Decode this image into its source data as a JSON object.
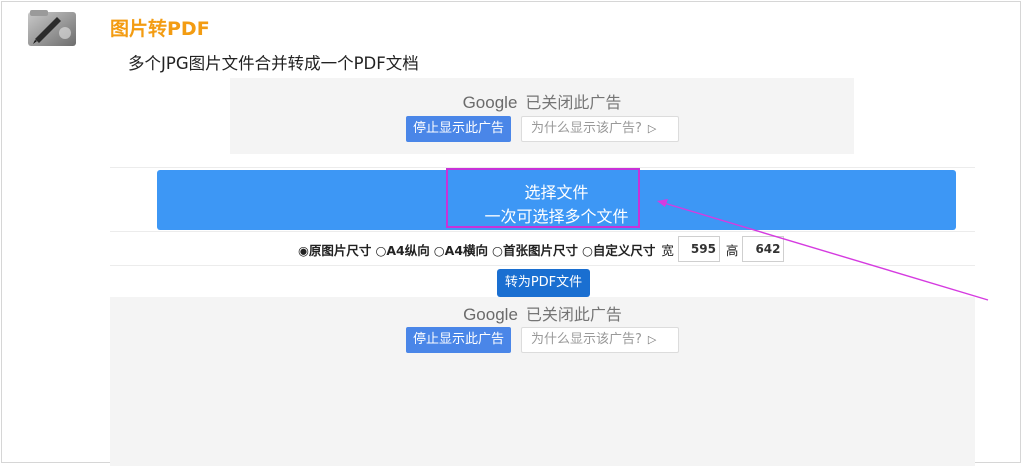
{
  "header": {
    "logo_icon": "pdf-tool-logo-icon",
    "title": "图片转PDF",
    "subtitle": "多个JPG图片文件合并转成一个PDF文档"
  },
  "ads": [
    {
      "brand": "Google",
      "status_text": "已关闭此广告",
      "stop_label": "停止显示此广告",
      "why_label": "为什么显示该广告?"
    },
    {
      "brand": "Google",
      "status_text": "已关闭此广告",
      "stop_label": "停止显示此广告",
      "why_label": "为什么显示该广告?"
    }
  ],
  "select_files": {
    "line1": "选择文件",
    "line2": "一次可选择多个文件"
  },
  "size_options": {
    "items": [
      {
        "label": "原图片尺寸",
        "selected": true
      },
      {
        "label": "A4纵向",
        "selected": false
      },
      {
        "label": "A4横向",
        "selected": false
      },
      {
        "label": "首张图片尺寸",
        "selected": false
      },
      {
        "label": "自定义尺寸",
        "selected": false
      }
    ],
    "width_label": "宽",
    "width_value": "595",
    "height_label": "高",
    "height_value": "642"
  },
  "convert_button": "转为PDF文件",
  "colors": {
    "title": "#f39c12",
    "select_button": "#3d97f5",
    "convert_button": "#1a6fd1",
    "highlight": "#c832d8",
    "ad_stop_button": "#4a86e8"
  }
}
